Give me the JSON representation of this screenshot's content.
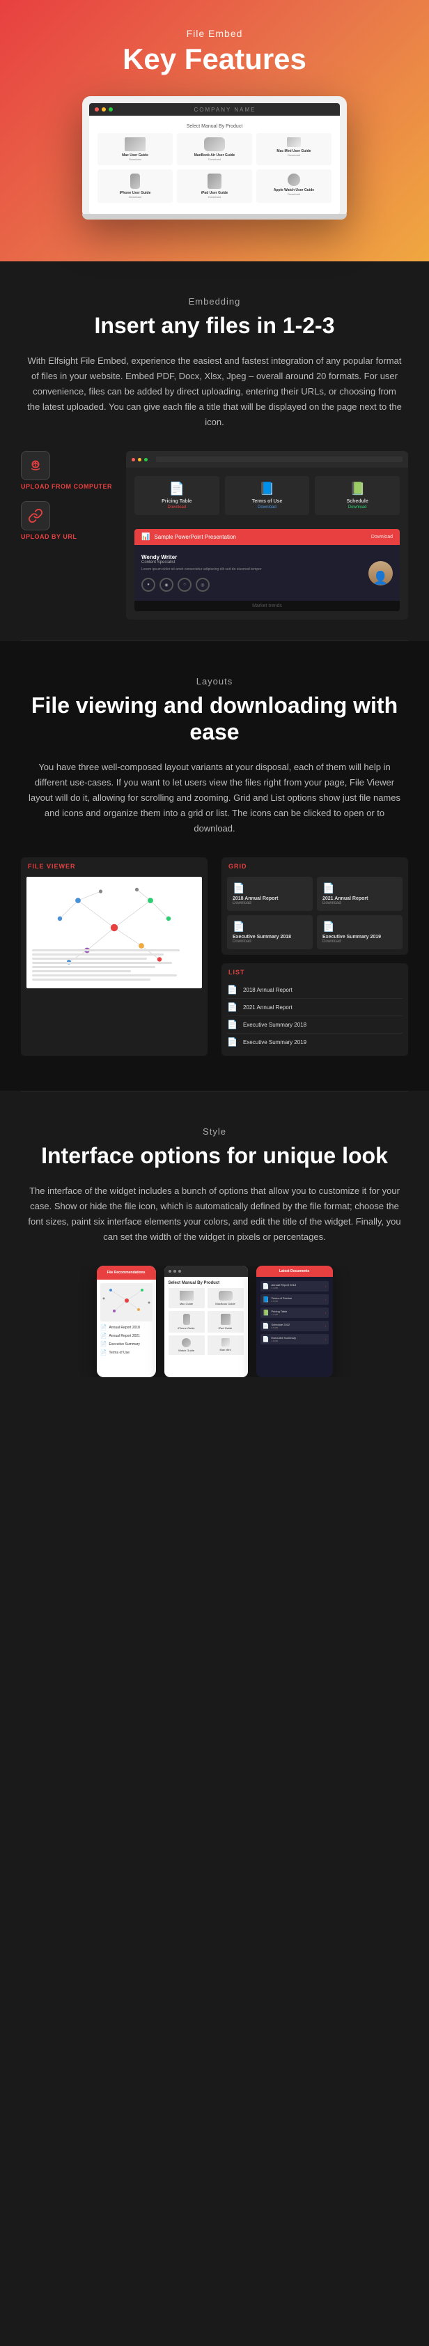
{
  "hero": {
    "subtitle": "File Embed",
    "title": "Key Features",
    "laptop": {
      "company": "COMPANY NAME",
      "select_label": "Select Manual By Product",
      "products": [
        {
          "name": "Mac User Guide",
          "desc": "Download"
        },
        {
          "name": "MacBook Air User Guide",
          "desc": "Download"
        },
        {
          "name": "Mac Mini User Guide",
          "desc": "Download"
        },
        {
          "name": "iPhone User Guide",
          "desc": "Download"
        },
        {
          "name": "iPad User Guide",
          "desc": "Download"
        },
        {
          "name": "Apple Watch User Guide",
          "desc": "Download"
        }
      ]
    }
  },
  "embedding": {
    "label": "Embedding",
    "title": "Insert any files in 1-2-3",
    "text": "With Elfsight File Embed, experience the easiest and fastest integration of any popular format of files in your website. Embed PDF, Docx, Xlsx, Jpeg – overall around 20 formats. For user convenience, files can be added by direct uploading, entering their URLs, or choosing from the latest uploaded. You can give each file a title that will be displayed on the page next to the icon.",
    "upload_computer_label": "UPLOAD FROM COMPUTER",
    "upload_url_label": "UPLOAD BY URL",
    "files": [
      {
        "name": "Pricing Table",
        "action": "Download",
        "color": "#e84040"
      },
      {
        "name": "Terms of Use",
        "action": "Download",
        "color": "#4a90d9"
      },
      {
        "name": "Schedule",
        "action": "Download",
        "color": "#2ecc71"
      }
    ],
    "ppt": {
      "title": "Sample PowerPoint Presentation",
      "download": "Download",
      "presenter": "Wendy Writer",
      "role": "Content Specialist",
      "desc": "Lorem ipsum dolor sit amet consectetur adipiscing elit sed do eiusmod tempor",
      "footer": "Market trends"
    }
  },
  "layouts": {
    "label": "Layouts",
    "title": "File viewing and downloading with ease",
    "text": "You have three well-composed layout variants at your disposal, each of them will help in different use-cases. If you want to let users view the files right from your page, File Viewer layout will do it, allowing for scrolling and zooming. Grid and List options show just file names and icons and organize them into a grid or list. The icons can be clicked to open or to download.",
    "file_viewer_label": "FILE VIEWER",
    "grid_label": "GRID",
    "list_label": "LIST",
    "grid_files": [
      {
        "name": "2018 Annual Report",
        "sub": "Download",
        "icon": "📄"
      },
      {
        "name": "2021 Annual Report",
        "sub": "Download",
        "icon": "📄"
      },
      {
        "name": "Executive Summary 2018",
        "sub": "Download",
        "icon": "📄"
      },
      {
        "name": "Executive Summary 2019",
        "sub": "Download",
        "icon": "📄"
      }
    ],
    "list_files": [
      {
        "name": "2018 Annual Report",
        "icon": "📄"
      },
      {
        "name": "2021 Annual Report",
        "icon": "📄"
      },
      {
        "name": "Executive Summary 2018",
        "icon": "📄"
      },
      {
        "name": "Executive Summary 2019",
        "icon": "📄"
      }
    ]
  },
  "style": {
    "label": "Style",
    "title": "Interface options for unique look",
    "text": "The interface of the widget includes a bunch of options that allow you to customize it for your case. Show or hide the file icon, which is automatically defined by the file format; choose the font sizes, paint six interface elements your colors, and edit the title of the widget. Finally, you can set the width of the widget in pixels or percentages.",
    "mockup1_title": "File Recommendations",
    "mockup2_title": "Select Manual By Product",
    "mockup3_title": "Latest Documents"
  },
  "colors": {
    "accent": "#e84040",
    "blue": "#4a90d9",
    "green": "#2ecc71",
    "bg_dark": "#1a1a1a",
    "bg_medium": "#111111",
    "text_muted": "#aaaaaa"
  }
}
